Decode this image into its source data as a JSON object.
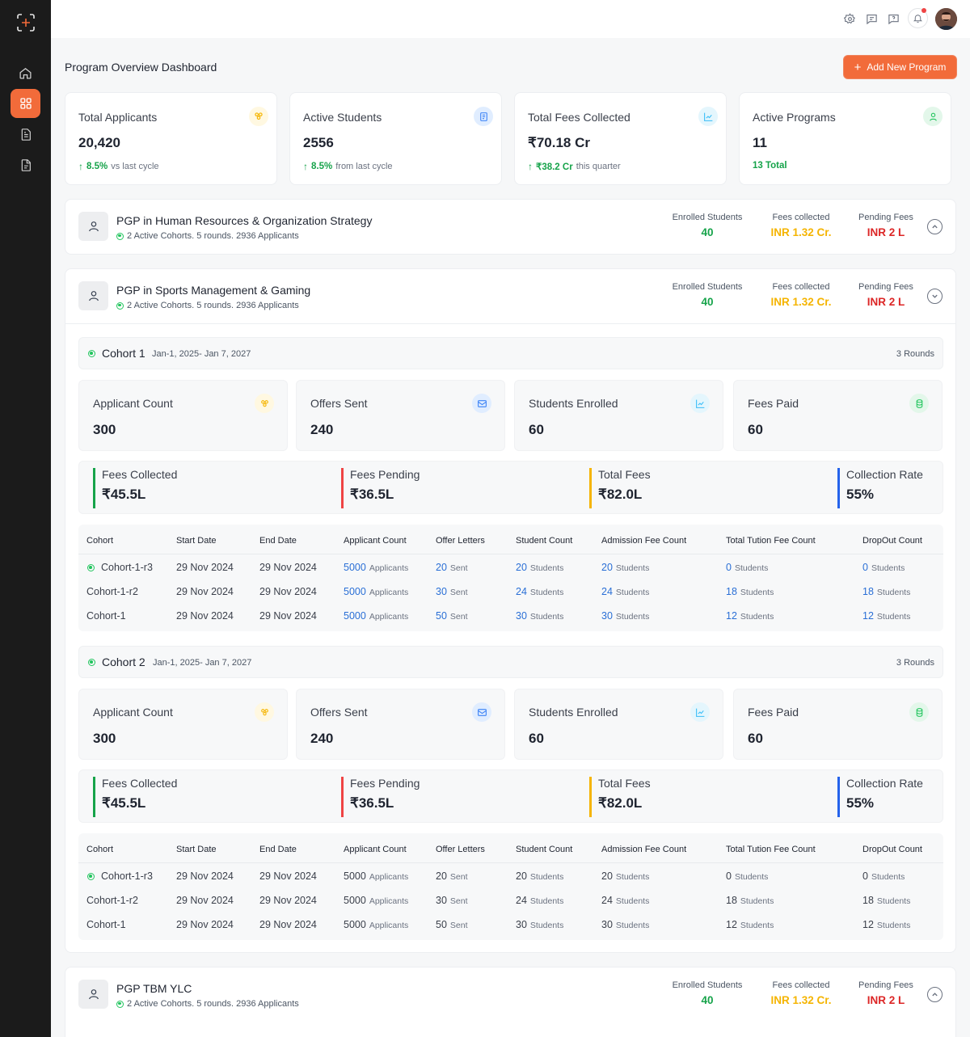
{
  "topbar": {
    "icons": [
      "settings-icon",
      "chat-icon",
      "help-icon",
      "bell-icon"
    ],
    "notification_color": "#ef4444"
  },
  "sidebar": {
    "items": [
      "home-icon",
      "grid-icon",
      "document-icon",
      "file-icon"
    ],
    "accent": "#f26b3a"
  },
  "header": {
    "title": "Program Overview Dashboard",
    "add_button": "Add New Program",
    "add_icon": "+"
  },
  "stats": [
    {
      "label": "Total Applicants",
      "value": "20,420",
      "delta": "8.5%",
      "suffix": "vs last cycle",
      "icon": "users-icon",
      "color": "#f5b400"
    },
    {
      "label": "Active Students",
      "value": "2556",
      "delta": "8.5%",
      "suffix": "from last cycle",
      "icon": "id-card-icon",
      "color": "#3b82f6"
    },
    {
      "label": "Total Fees Collected",
      "value": "₹70.18 Cr",
      "delta": "₹38.2 Cr",
      "suffix": "this quarter",
      "icon": "chart-icon",
      "color": "#38bdf8"
    },
    {
      "label": "Active Programs",
      "value": "11",
      "delta": "13 Total",
      "suffix": "",
      "icon": "user-icon",
      "color": "#22c55e"
    }
  ],
  "programs": [
    {
      "name": "PGP in Human Resources & Organization Strategy",
      "sub": "2 Active Cohorts. 5 rounds. 2936 Applicants",
      "enrolled_label": "Enrolled Students",
      "enrolled": "40",
      "collected_label": "Fees collected",
      "collected": "INR 1.32 Cr.",
      "pending_label": "Pending Fees",
      "pending": "INR 2 L"
    },
    {
      "name": "PGP in Sports Management & Gaming",
      "sub": "2 Active Cohorts. 5 rounds. 2936 Applicants",
      "enrolled_label": "Enrolled Students",
      "enrolled": "40",
      "collected_label": "Fees collected",
      "collected": "INR 1.32 Cr.",
      "pending_label": "Pending Fees",
      "pending": "INR 2 L"
    },
    {
      "name": "PGP TBM YLC",
      "sub": "2 Active Cohorts. 5 rounds. 2936 Applicants",
      "enrolled_label": "Enrolled Students",
      "enrolled": "40",
      "collected_label": "Fees collected",
      "collected": "INR 1.32 Cr.",
      "pending_label": "Pending Fees",
      "pending": "INR 2 L"
    }
  ],
  "cohorts": [
    {
      "title": "Cohort 1",
      "dates": "Jan-1, 2025- Jan 7, 2027",
      "rounds": "3 Rounds",
      "minis": [
        {
          "label": "Applicant Count",
          "value": "300"
        },
        {
          "label": "Offers Sent",
          "value": "240"
        },
        {
          "label": "Students Enrolled",
          "value": "60"
        },
        {
          "label": "Fees Paid",
          "value": "60"
        }
      ],
      "fees": [
        {
          "label": "Fees Collected",
          "value": "₹45.5L"
        },
        {
          "label": "Fees Pending",
          "value": "₹36.5L"
        },
        {
          "label": "Total Fees",
          "value": "₹82.0L"
        },
        {
          "label": "Collection Rate",
          "value": "55%"
        }
      ],
      "rows": [
        {
          "cohort": "Cohort-1-r3",
          "start": "29 Nov 2024",
          "end": "29 Nov 2024",
          "applicants": "5000",
          "offers": "20",
          "students": "20",
          "admission": "20",
          "tuition": "0",
          "dropout": "0"
        },
        {
          "cohort": "Cohort-1-r2",
          "start": "29 Nov 2024",
          "end": "29 Nov 2024",
          "applicants": "5000",
          "offers": "30",
          "students": "24",
          "admission": "24",
          "tuition": "18",
          "dropout": "18"
        },
        {
          "cohort": "Cohort-1",
          "start": "29 Nov 2024",
          "end": "29 Nov 2024",
          "applicants": "5000",
          "offers": "50",
          "students": "30",
          "admission": "30",
          "tuition": "12",
          "dropout": "12"
        }
      ]
    },
    {
      "title": "Cohort 2",
      "dates": "Jan-1, 2025- Jan 7, 2027",
      "rounds": "3 Rounds",
      "minis": [
        {
          "label": "Applicant Count",
          "value": "300"
        },
        {
          "label": "Offers Sent",
          "value": "240"
        },
        {
          "label": "Students Enrolled",
          "value": "60"
        },
        {
          "label": "Fees Paid",
          "value": "60"
        }
      ],
      "fees": [
        {
          "label": "Fees Collected",
          "value": "₹45.5L"
        },
        {
          "label": "Fees Pending",
          "value": "₹36.5L"
        },
        {
          "label": "Total Fees",
          "value": "₹82.0L"
        },
        {
          "label": "Collection Rate",
          "value": "55%"
        }
      ],
      "rows": [
        {
          "cohort": "Cohort-1-r3",
          "start": "29 Nov 2024",
          "end": "29 Nov 2024",
          "applicants": "5000",
          "offers": "20",
          "students": "20",
          "admission": "20",
          "tuition": "0",
          "dropout": "0"
        },
        {
          "cohort": "Cohort-1-r2",
          "start": "29 Nov 2024",
          "end": "29 Nov 2024",
          "applicants": "5000",
          "offers": "30",
          "students": "24",
          "admission": "24",
          "tuition": "18",
          "dropout": "18"
        },
        {
          "cohort": "Cohort-1",
          "start": "29 Nov 2024",
          "end": "29 Nov 2024",
          "applicants": "5000",
          "offers": "50",
          "students": "30",
          "admission": "30",
          "tuition": "12",
          "dropout": "12"
        }
      ]
    }
  ],
  "table": {
    "headers": [
      "Cohort",
      "Start Date",
      "End Date",
      "Applicant Count",
      "Offer Letters",
      "Student Count",
      "Admission Fee Count",
      "Total Tution Fee Count",
      "DropOut Count"
    ],
    "units": {
      "applicants": "Applicants",
      "offers": "Sent",
      "students": "Students"
    }
  },
  "colors": {
    "green": "#16a34a",
    "amber": "#f5b400",
    "red": "#dc2626",
    "blue": "#2a6fd6",
    "fee_bars": [
      "#16a34a",
      "#ef4444",
      "#f5b400",
      "#2563eb"
    ]
  }
}
